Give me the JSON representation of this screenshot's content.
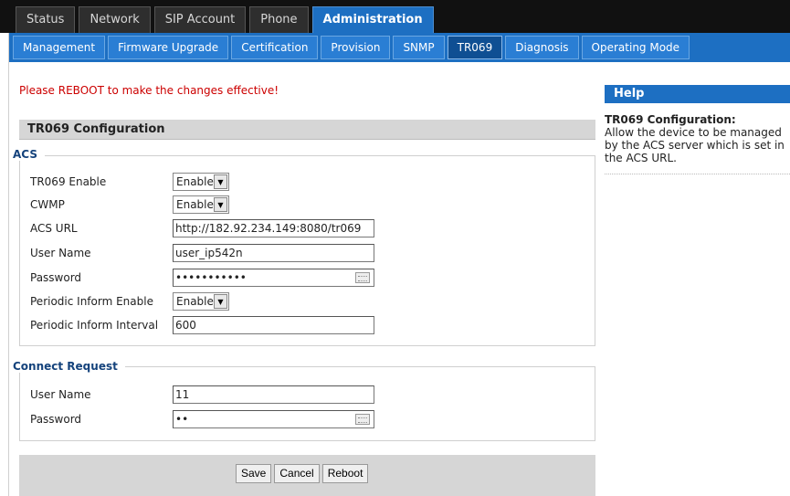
{
  "main_tabs": [
    "Status",
    "Network",
    "SIP Account",
    "Phone",
    "Administration"
  ],
  "sub_tabs": [
    "Management",
    "Firmware Upgrade",
    "Certification",
    "Provision",
    "SNMP",
    "TR069",
    "Diagnosis",
    "Operating Mode"
  ],
  "reboot_message": "Please REBOOT to make the changes effective!",
  "section_title": "TR069 Configuration",
  "acs": {
    "title": "ACS",
    "tr069_enable": {
      "label": "TR069 Enable",
      "value": "Enable"
    },
    "cwmp": {
      "label": "CWMP",
      "value": "Enable"
    },
    "acs_url": {
      "label": "ACS URL",
      "value": "http://182.92.234.149:8080/tr069"
    },
    "user_name": {
      "label": "User Name",
      "value": "user_ip542n"
    },
    "password": {
      "label": "Password",
      "value": "•••••••••••"
    },
    "periodic_inform_enable": {
      "label": "Periodic Inform Enable",
      "value": "Enable"
    },
    "periodic_inform_interval": {
      "label": "Periodic Inform Interval",
      "value": "600"
    }
  },
  "connect_request": {
    "title": "Connect Request",
    "user_name": {
      "label": "User Name",
      "value": "11"
    },
    "password": {
      "label": "Password",
      "value": "••"
    }
  },
  "buttons": {
    "save": "Save",
    "cancel": "Cancel",
    "reboot": "Reboot"
  },
  "help": {
    "header": "Help",
    "title": "TR069 Configuration:",
    "text": "Allow the device to be managed by the ACS server which is set in the ACS URL."
  },
  "colors": {
    "accent": "#1d6fc2",
    "warning": "#cc0000",
    "group_title": "#15437c"
  }
}
